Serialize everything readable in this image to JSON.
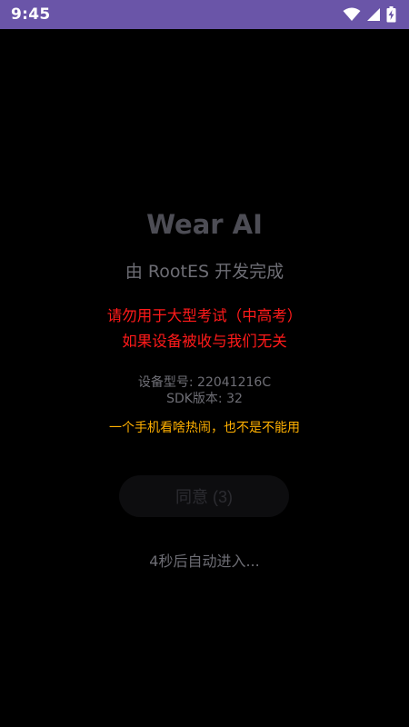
{
  "status_bar": {
    "time": "9:45",
    "icons": [
      "wifi-icon",
      "signal-icon",
      "battery-charging-icon"
    ]
  },
  "main": {
    "title": "Wear AI",
    "subtitle": "由 RootES 开发完成",
    "warning_line1": "请勿用于大型考试（中高考）",
    "warning_line2": "如果设备被收与我们无关",
    "device_model": "设备型号: 22041216C",
    "sdk_version": "SDK版本: 32",
    "joke": "一个手机看啥热闹，也不是不能用",
    "agree_button": "同意 (3)",
    "auto_enter": "4秒后自动进入..."
  },
  "colors": {
    "status_bar_bg": "#6a55a8",
    "warning": "#ff1a1a",
    "joke": "#ffb000",
    "background": "#000000"
  }
}
